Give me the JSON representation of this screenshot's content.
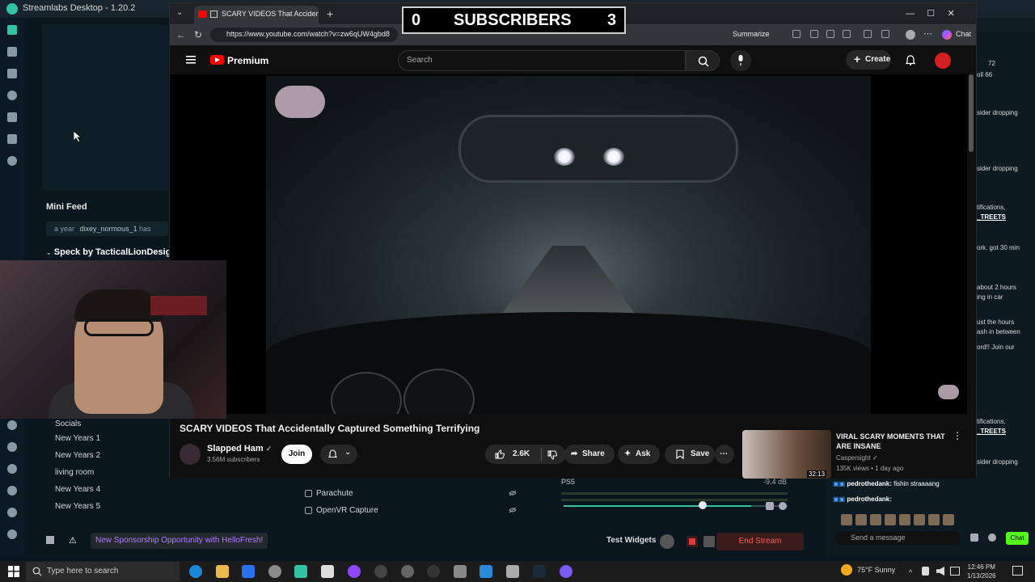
{
  "app": {
    "title": "Streamlabs Desktop - 1.20.2"
  },
  "overlay": {
    "left_count": "0",
    "label": "SUBSCRIBERS",
    "right_count": "3"
  },
  "browser": {
    "tab_title": "SCARY VIDEOS That Accidentally...",
    "url": "https://www.youtube.com/watch?v=zw6qUW4gbd8",
    "summarize": "Summarize",
    "chat": "Chat"
  },
  "youtube": {
    "brand": "Premium",
    "search_placeholder": "Search",
    "create": "Create",
    "video_title": "SCARY VIDEOS That Accidentally Captured Something Terrifying",
    "channel": "Slapped Ham",
    "subscribers": "3.56M subscribers",
    "join": "Join",
    "likes": "2.6K",
    "share": "Share",
    "ask": "Ask",
    "save": "Save",
    "rec": {
      "title": "VIRAL SCARY MOMENTS THAT ARE INSANE",
      "channel": "Caspersight",
      "meta": "135K views • 1 day ago",
      "duration": "32:13"
    }
  },
  "minifeed": {
    "title": "Mini Feed",
    "row_time": "a year",
    "row_user": "dixey_normous_1",
    "row_action": "has",
    "speck": "Speck by TacticalLionDesigns"
  },
  "scenes": [
    "Socials",
    "New Years 1",
    "New Years 2",
    "living room",
    "New Years 4",
    "New Years 5"
  ],
  "sources": [
    "Parachute",
    "OpenVR Capture"
  ],
  "mixer": {
    "name": "PS5",
    "db": "-9.4 dB",
    "level": 0.73
  },
  "footer": {
    "sponsor": "New Sponsorship Opportunity with HelloFresh!",
    "test_widgets": "Test Widgets",
    "end_stream": "End Stream"
  },
  "chat": {
    "lines": [
      "72",
      "oll 66",
      "sider dropping",
      "sider dropping",
      "tifications,",
      "_TREETS",
      "ork. got 30 min",
      " about 2 hours",
      "ing in car",
      "ust the hours",
      "ash in between",
      "ord!! Join our",
      "tifications,",
      "_TREETS",
      "sider dropping"
    ],
    "msg1_user": "pedrothedank:",
    "msg1_text": "fishin straaaang",
    "msg2_user": "pedrothedank:",
    "input_placeholder": "Send a message",
    "send": "Chat"
  },
  "taskbar": {
    "search": "Type here to search",
    "weather": "75°F  Sunny",
    "time": "12:46 PM",
    "date": "1/13/2026"
  }
}
